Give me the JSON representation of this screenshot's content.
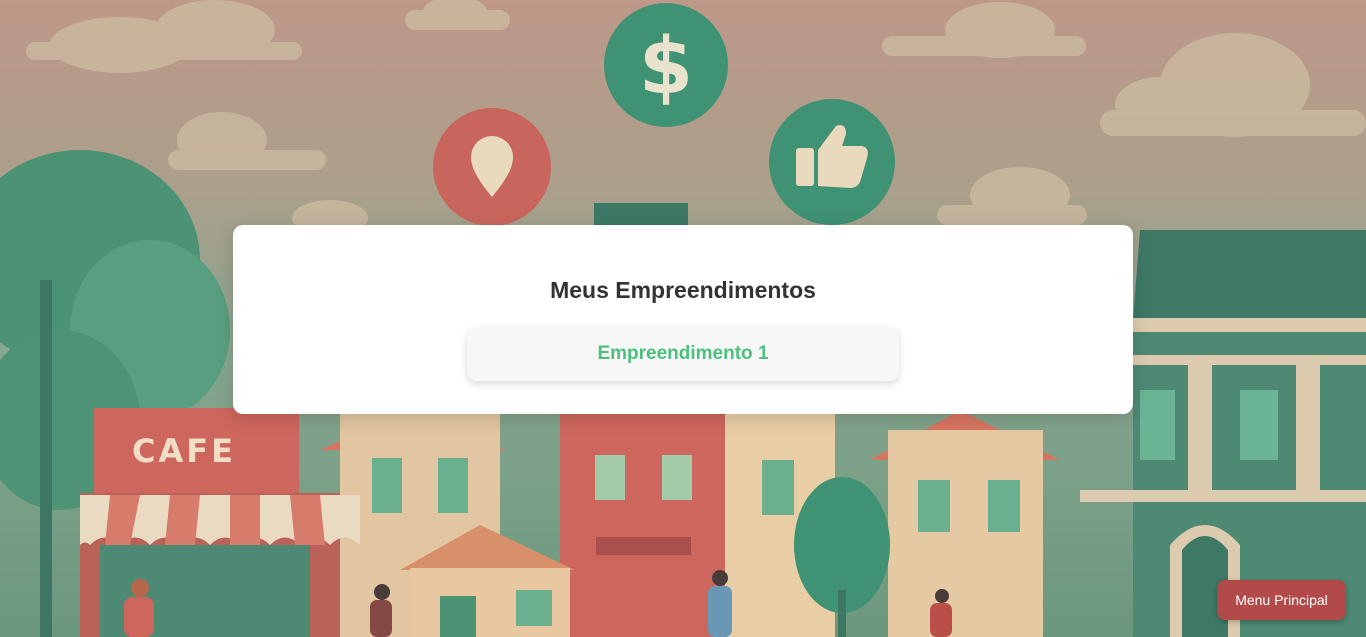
{
  "background": {
    "cafe_sign": "CAFE",
    "icons": [
      "dollar-icon",
      "location-pin-icon",
      "thumbs-up-icon"
    ]
  },
  "card": {
    "title": "Meus Empreendimentos",
    "items": [
      {
        "label": "Empreendimento 1"
      }
    ]
  },
  "footer": {
    "menu_label": "Menu Principal"
  },
  "colors": {
    "accent_green": "#4cc07f",
    "menu_red": "#b24a4a",
    "icon_green": "#2f8a69",
    "icon_red": "#c45a50"
  }
}
